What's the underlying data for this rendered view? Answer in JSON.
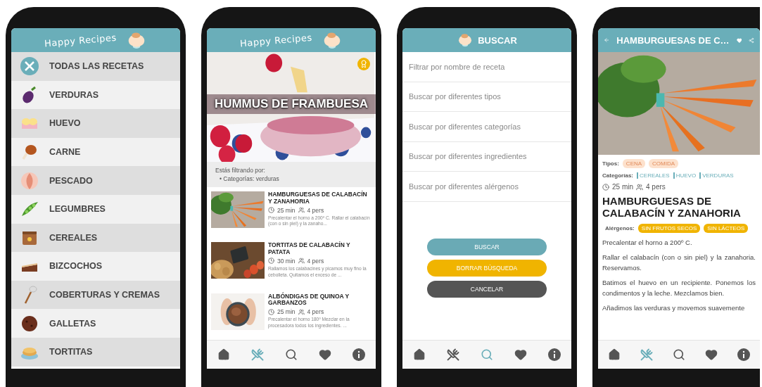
{
  "menu_screen": {
    "header": {
      "title": "Happy Recipes"
    },
    "categories": [
      "TODAS LAS RECETAS",
      "VERDURAS",
      "HUEVO",
      "CARNE",
      "PESCADO",
      "LEGUMBRES",
      "CEREALES",
      "BIZCOCHOS",
      "COBERTURAS Y CREMAS",
      "GALLETAS",
      "TORTITAS"
    ]
  },
  "list_screen": {
    "header": {
      "title": "Happy Recipes"
    },
    "hero": {
      "title": "HUMMUS DE FRAMBUESA"
    },
    "filter": {
      "heading": "Estás filtrando por:",
      "items": [
        "• Categorías: verduras"
      ]
    },
    "recipes": [
      {
        "title": "HAMBURGUESAS DE CALABACÍN Y ZANAHORIA",
        "time": "25 min",
        "people": "4 pers",
        "excerpt": "Precalentar el horno a 200º C. Rallar el calabacín (con o sin piel) y la zanaho..."
      },
      {
        "title": "TORTITAS DE CALABACÍN Y PATATA",
        "time": "30 min",
        "people": "4 pers",
        "excerpt": "Rallamos los calabacines y picamos muy fino la cebolleta. Quitamos el exceso de ..."
      },
      {
        "title": "ALBÓNDIGAS DE QUINOA Y GARBANZOS",
        "time": "25 min",
        "people": "4 pers",
        "excerpt": "Precalentar el horno 180º Mezclar en la procesadora todos los ingredientes. ..."
      }
    ],
    "nav": [
      {
        "selected": false
      },
      {
        "selected": true
      },
      {
        "selected": false
      },
      {
        "selected": false
      },
      {
        "selected": false
      }
    ]
  },
  "search_screen": {
    "header": {
      "title": "BUSCAR"
    },
    "fields": [
      {
        "placeholder": "Filtrar por nombre de receta"
      },
      {
        "placeholder": "Buscar por diferentes tipos"
      },
      {
        "placeholder": "Buscar por diferentes categorías"
      },
      {
        "placeholder": "Buscar por diferentes ingredientes"
      },
      {
        "placeholder": "Buscar por diferentes alérgenos"
      }
    ],
    "buttons": [
      {
        "label": "BUSCAR",
        "kind": "primary"
      },
      {
        "label": "BORRAR BÚSQUEDA",
        "kind": "warning"
      },
      {
        "label": "CANCELAR",
        "kind": "dark"
      }
    ],
    "nav": [
      {
        "selected": false
      },
      {
        "selected": false
      },
      {
        "selected": true
      },
      {
        "selected": false
      },
      {
        "selected": false
      }
    ]
  },
  "detail_screen": {
    "header": {
      "title": "HAMBURGUESAS DE C…"
    },
    "types_label": "Tipos:",
    "types": [
      "CENA",
      "COMIDA"
    ],
    "categories_label": "Categorías:",
    "categories": [
      "CEREALES",
      "HUEVO",
      "VERDURAS"
    ],
    "time": "25 min",
    "people": "4 pers",
    "title": "HAMBURGUESAS DE CALABACÍN Y ZANAHORIA",
    "allergens_label": "Alérgenos:",
    "allergens": [
      "SIN FRUTOS SECOS",
      "SIN LÁCTEOS"
    ],
    "paragraphs": [
      "Precalentar el horno a 200º C.",
      "Rallar el calabacín (con o sin piel) y la zanahoria. Reservamos.",
      "Batimos el huevo en un recipiente. Ponemos los condimentos y la leche. Mezclamos bien.",
      "Añadimos las verduras y movemos suavemente"
    ],
    "nav": [
      {
        "selected": false
      },
      {
        "selected": true
      },
      {
        "selected": false
      },
      {
        "selected": false
      },
      {
        "selected": false
      }
    ]
  }
}
